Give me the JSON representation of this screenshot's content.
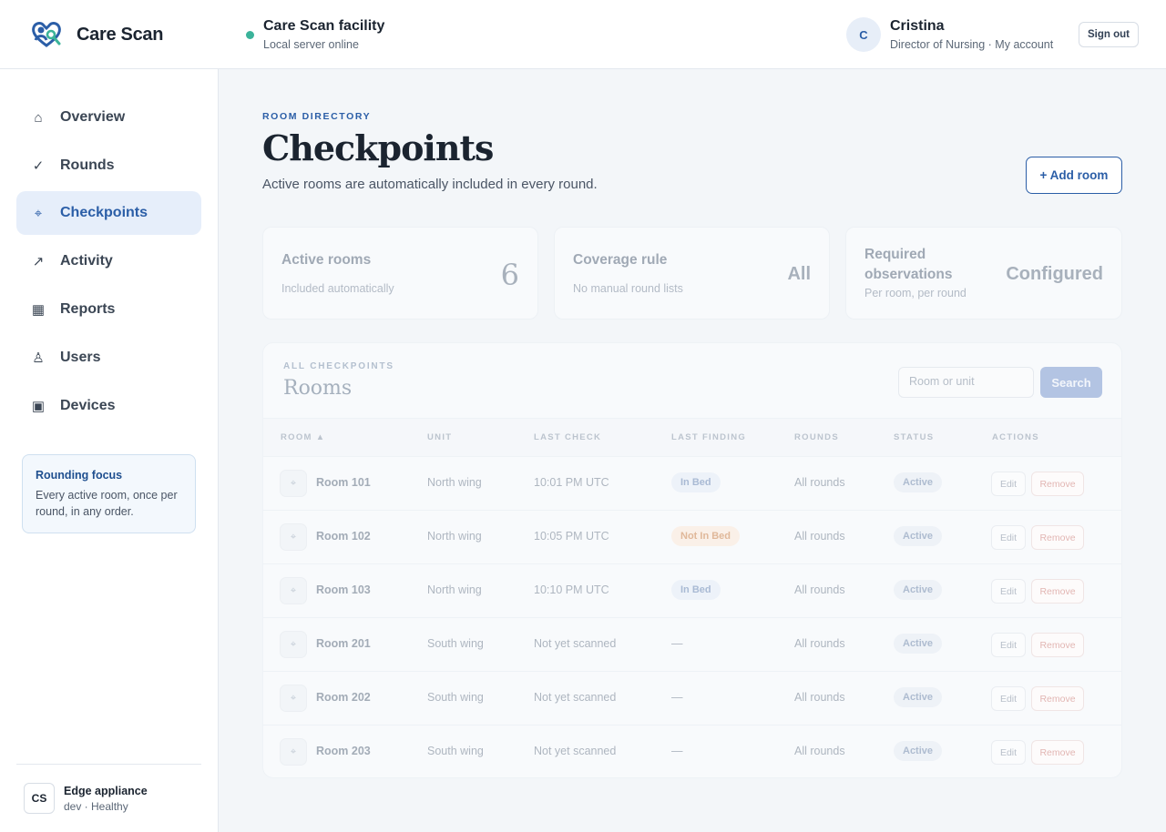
{
  "brand": {
    "name": "Care Scan"
  },
  "facility": {
    "name": "Care Scan facility",
    "status": "Local server online"
  },
  "user": {
    "initial": "C",
    "name": "Cristina",
    "role": "Director of Nursing · My account",
    "signout": "Sign out"
  },
  "sidebar": {
    "items": [
      {
        "label": "Overview",
        "icon": "⌂"
      },
      {
        "label": "Rounds",
        "icon": "✓"
      },
      {
        "label": "Checkpoints",
        "icon": "⌖"
      },
      {
        "label": "Activity",
        "icon": "↗"
      },
      {
        "label": "Reports",
        "icon": "▦"
      },
      {
        "label": "Users",
        "icon": "♙"
      },
      {
        "label": "Devices",
        "icon": "▣"
      }
    ],
    "active": "Checkpoints",
    "focus": {
      "title": "Rounding focus",
      "text": "Every active room, once per round, in any order."
    },
    "edge": {
      "badge": "CS",
      "name": "Edge appliance",
      "status": "dev · Healthy"
    }
  },
  "header": {
    "eyebrow": "ROOM DIRECTORY",
    "title": "Checkpoints",
    "subtitle": "Active rooms are automatically included in every round.",
    "add_button": "+ Add room"
  },
  "stats": [
    {
      "label": "Active rooms",
      "sub": "Included automatically",
      "value": "6"
    },
    {
      "label": "Coverage rule",
      "sub": "No manual round lists",
      "value": "All"
    },
    {
      "label": "Required observations",
      "sub": "Per room, per round",
      "value": "Configured"
    }
  ],
  "table": {
    "eyebrow": "ALL CHECKPOINTS",
    "title": "Rooms",
    "search_placeholder": "Room or unit",
    "search_button": "Search",
    "columns": [
      "ROOM ▲",
      "UNIT",
      "LAST CHECK",
      "LAST FINDING",
      "ROUNDS",
      "STATUS",
      "ACTIONS"
    ],
    "rows": [
      {
        "room": "Room 101",
        "unit": "North wing",
        "last_check": "10:01 PM UTC",
        "finding": "In Bed",
        "finding_type": "inbed",
        "rounds": "All rounds",
        "status": "Active"
      },
      {
        "room": "Room 102",
        "unit": "North wing",
        "last_check": "10:05 PM UTC",
        "finding": "Not In Bed",
        "finding_type": "notinbed",
        "rounds": "All rounds",
        "status": "Active"
      },
      {
        "room": "Room 103",
        "unit": "North wing",
        "last_check": "10:10 PM UTC",
        "finding": "In Bed",
        "finding_type": "inbed",
        "rounds": "All rounds",
        "status": "Active"
      },
      {
        "room": "Room 201",
        "unit": "South wing",
        "last_check": "Not yet scanned",
        "finding": "—",
        "finding_type": "none",
        "rounds": "All rounds",
        "status": "Active"
      },
      {
        "room": "Room 202",
        "unit": "South wing",
        "last_check": "Not yet scanned",
        "finding": "—",
        "finding_type": "none",
        "rounds": "All rounds",
        "status": "Active"
      },
      {
        "room": "Room 203",
        "unit": "South wing",
        "last_check": "Not yet scanned",
        "finding": "—",
        "finding_type": "none",
        "rounds": "All rounds",
        "status": "Active"
      }
    ],
    "edit_label": "Edit",
    "remove_label": "Remove",
    "row_icon": "⌖"
  }
}
